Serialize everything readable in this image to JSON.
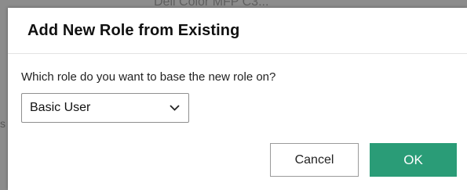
{
  "background": {
    "partial_text": "Dell Color MFP C3...",
    "edge_letter": "s"
  },
  "dialog": {
    "title": "Add New Role from Existing",
    "question": "Which role do you want to base the new role on?",
    "select": {
      "value": "Basic User",
      "icon": "chevron-down-icon"
    },
    "buttons": {
      "cancel_label": "Cancel",
      "ok_label": "OK"
    }
  },
  "colors": {
    "ok_button": "#2a9c77",
    "overlay": "#8c8c8c"
  }
}
